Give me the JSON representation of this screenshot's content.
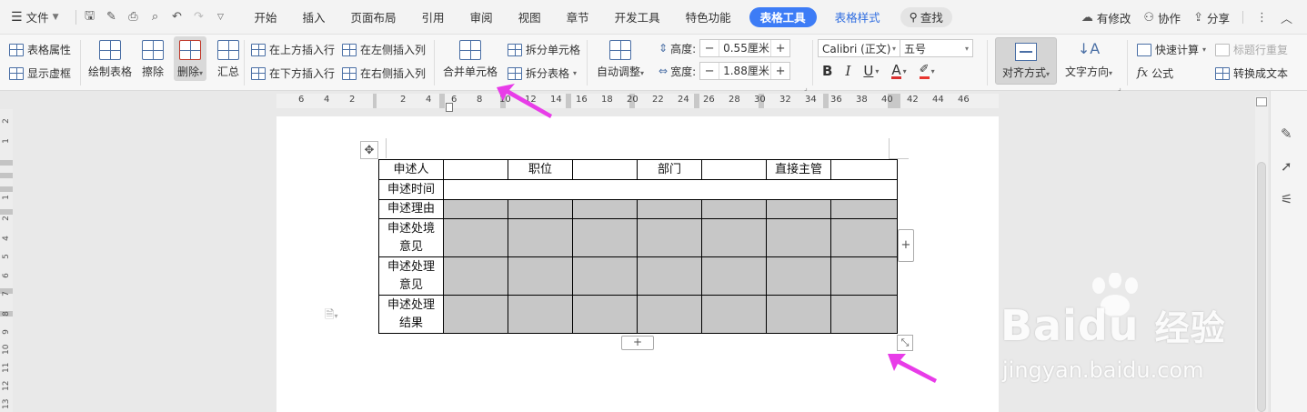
{
  "menubar": {
    "file_label": "文件",
    "tabs": [
      "开始",
      "插入",
      "页面布局",
      "引用",
      "审阅",
      "视图",
      "章节",
      "开发工具",
      "特色功能"
    ],
    "active_tab": "表格工具",
    "styles_tab": "表格样式",
    "search_label": "查找",
    "right": {
      "modified": "有修改",
      "collab": "协作",
      "share": "分享"
    }
  },
  "ribbon": {
    "table_props": "表格属性",
    "show_gridlines": "显示虚框",
    "draw_table": "绘制表格",
    "erase": "擦除",
    "delete": "删除",
    "summary": "汇总",
    "insert_above": "在上方插入行",
    "insert_below": "在下方插入行",
    "insert_left": "在左侧插入列",
    "insert_right": "在右侧插入列",
    "merge_cells": "合并单元格",
    "split_cells": "拆分单元格",
    "split_table": "拆分表格",
    "auto_fit": "自动调整",
    "height_label": "高度:",
    "height_value": "0.55厘米",
    "width_label": "宽度:",
    "width_value": "1.88厘米",
    "font_name": "Calibri (正文)",
    "font_size": "五号",
    "align": "对齐方式",
    "text_direction": "文字方向",
    "quick_calc": "快速计算",
    "header_repeat": "标题行重复",
    "formula": "公式",
    "to_text": "转换成文本"
  },
  "ruler": {
    "h": [
      "6",
      "4",
      "2",
      "2",
      "4",
      "6",
      "8",
      "10",
      "12",
      "14",
      "16",
      "18",
      "20",
      "22",
      "24",
      "26",
      "28",
      "30",
      "32",
      "34",
      "36",
      "38",
      "40",
      "42",
      "44",
      "46"
    ],
    "v": [
      "2",
      "1",
      "1",
      "2",
      "3",
      "4",
      "5",
      "6",
      "7",
      "8",
      "9",
      "10",
      "11",
      "12",
      "13"
    ]
  },
  "table": {
    "row1": [
      "申述人",
      "",
      "职位",
      "",
      "部门",
      "",
      "直接主管",
      ""
    ],
    "row2_label": "申述时间",
    "row3_label": "申述理由",
    "row4_label": [
      "申述处境",
      "意见"
    ],
    "row5_label": [
      "申述处理",
      "意见"
    ],
    "row6_label": [
      "申述处理",
      "结果"
    ]
  },
  "watermark": {
    "brand": "Baidu",
    "brand_cn": "经验",
    "url": "jingyan.baidu.com"
  },
  "colors": {
    "accent": "#3d7cf6",
    "annotation_arrow": "#e83ce8",
    "shaded_cell": "#c7c7c7"
  }
}
